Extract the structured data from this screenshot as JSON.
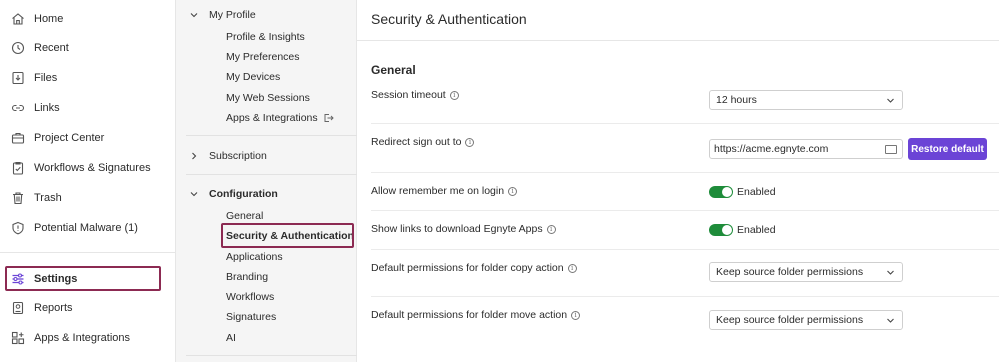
{
  "nav": {
    "items": [
      {
        "label": "Home",
        "icon": "home-icon"
      },
      {
        "label": "Recent",
        "icon": "clock-icon"
      },
      {
        "label": "Files",
        "icon": "files-icon"
      },
      {
        "label": "Links",
        "icon": "link-icon"
      },
      {
        "label": "Project Center",
        "icon": "briefcase-icon"
      },
      {
        "label": "Workflows & Signatures",
        "icon": "clipboard-check-icon"
      },
      {
        "label": "Trash",
        "icon": "trash-icon"
      },
      {
        "label": "Potential Malware (1)",
        "icon": "shield-alert-icon"
      },
      {
        "label": "Settings",
        "icon": "sliders-icon"
      },
      {
        "label": "Reports",
        "icon": "report-icon"
      },
      {
        "label": "Apps & Integrations",
        "icon": "apps-icon"
      }
    ],
    "active": "Settings"
  },
  "settings_nav": {
    "my_profile": {
      "label": "My Profile",
      "items": [
        "Profile & Insights",
        "My Preferences",
        "My Devices",
        "My Web Sessions",
        "Apps & Integrations"
      ]
    },
    "subscription": {
      "label": "Subscription"
    },
    "configuration": {
      "label": "Configuration",
      "items": [
        "General",
        "Security & Authentication",
        "Applications",
        "Branding",
        "Workflows",
        "Signatures",
        "AI"
      ]
    },
    "active": "Security & Authentication"
  },
  "main": {
    "title": "Security & Authentication",
    "section": "General",
    "rows": {
      "session_timeout": {
        "label": "Session timeout",
        "value": "12 hours"
      },
      "redirect": {
        "label": "Redirect sign out to",
        "value": "https://acme.egnyte.com",
        "button": "Restore default"
      },
      "remember_me": {
        "label": "Allow remember me on login",
        "state": "Enabled",
        "on": true
      },
      "show_links": {
        "label": "Show links to download Egnyte Apps",
        "state": "Enabled",
        "on": true
      },
      "copy_perms": {
        "label": "Default permissions for folder copy action",
        "value": "Keep source folder permissions"
      },
      "move_perms": {
        "label": "Default permissions for folder move action",
        "value": "Keep source folder permissions"
      }
    }
  },
  "colors": {
    "accent_button": "#6b44d6",
    "toggle_on": "#1e8c3a",
    "highlight_box": "#8c2a52"
  }
}
